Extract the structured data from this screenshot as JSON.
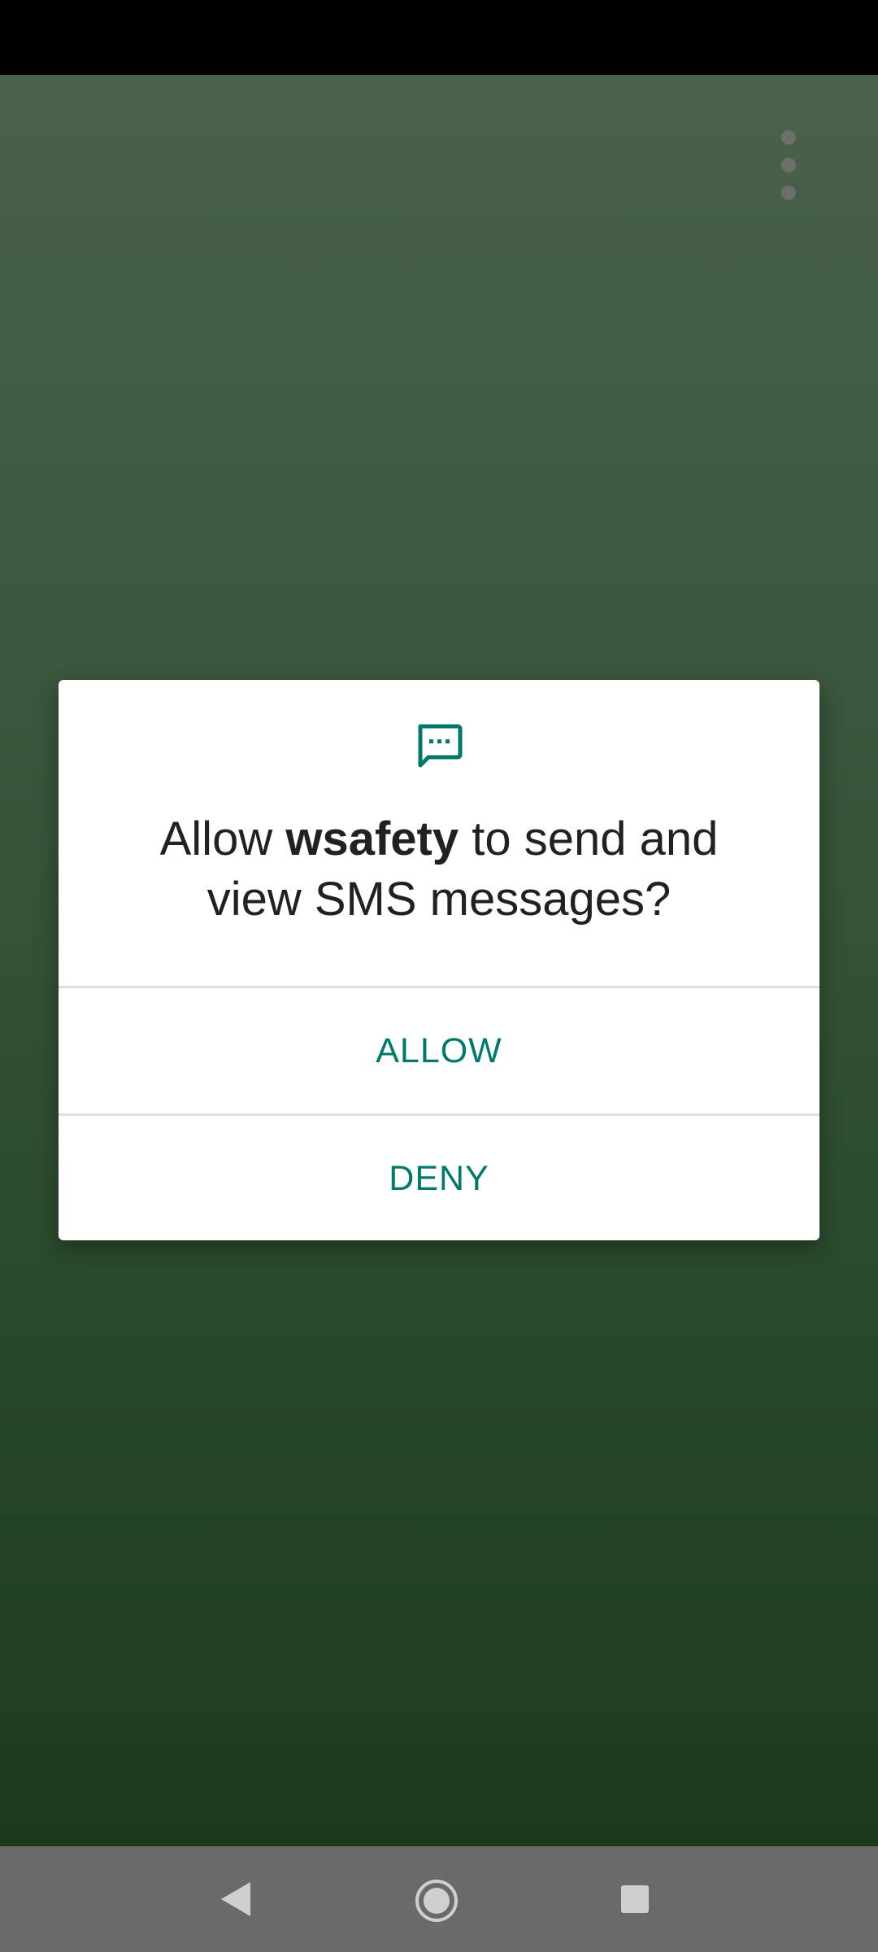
{
  "background_app": {
    "overflow_menu_icon": "more-vert-icon"
  },
  "permission_dialog": {
    "icon": "sms-message-icon",
    "accent_color": "#00796b",
    "title_prefix": "Allow ",
    "app_name": "wsafety",
    "title_suffix": " to send and view SMS messages?",
    "allow_label": "ALLOW",
    "deny_label": "DENY"
  },
  "nav_bar": {
    "back_icon": "back-triangle-icon",
    "home_icon": "home-circle-icon",
    "recents_icon": "recents-square-icon"
  }
}
